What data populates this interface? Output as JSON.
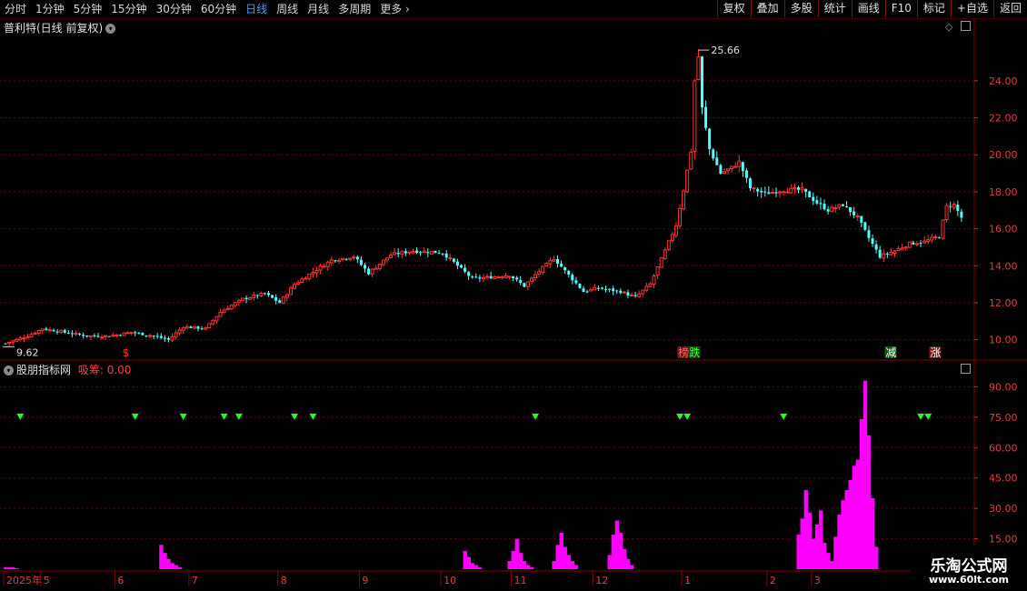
{
  "toolbar": {
    "periods": [
      {
        "label": "分时",
        "active": false
      },
      {
        "label": "1分钟",
        "active": false
      },
      {
        "label": "5分钟",
        "active": false
      },
      {
        "label": "15分钟",
        "active": false
      },
      {
        "label": "30分钟",
        "active": false
      },
      {
        "label": "60分钟",
        "active": false
      },
      {
        "label": "日线",
        "active": true
      },
      {
        "label": "周线",
        "active": false
      },
      {
        "label": "月线",
        "active": false
      },
      {
        "label": "多周期",
        "active": false
      },
      {
        "label": "更多",
        "active": false
      }
    ],
    "more_arrow": "›",
    "right_buttons": [
      "复权",
      "叠加",
      "多股",
      "统计",
      "画线",
      "F10",
      "标记",
      "+自选",
      "返回"
    ]
  },
  "main_chart": {
    "title": "普利特(日线 前复权)",
    "max_label": "25.66",
    "min_label": "9.62",
    "markers": [
      {
        "text": "$",
        "color": "#ff3030"
      },
      {
        "text": "榜",
        "color": "#ff6a6a",
        "bg": "#6a1010"
      },
      {
        "text": "跌",
        "color": "#30ff30",
        "bg": "#0a4a0a"
      },
      {
        "text": "减",
        "color": "#ffffff",
        "bg": "#0a5a0a"
      },
      {
        "text": "涨",
        "color": "#ffffff",
        "bg": "#7a1010"
      }
    ]
  },
  "indicator": {
    "title": "股朋指标网",
    "series_label": "吸筹: 0.00"
  },
  "chart_data": [
    {
      "type": "candlestick",
      "title": "普利特(日线 前复权)",
      "ylim": [
        9.0,
        26.5
      ],
      "y_ticks": [
        10,
        12,
        14,
        16,
        18,
        20,
        22,
        24
      ],
      "y_tick_labels": [
        "10.00",
        "12.00",
        "14.00",
        "16.00",
        "18.00",
        "20.00",
        "22.00",
        "24.00"
      ],
      "x_labels": [
        "2025年",
        "5",
        "6",
        "7",
        "8",
        "9",
        "10",
        "11",
        "12",
        "1",
        "2",
        "3"
      ],
      "x_label_index": [
        0,
        10,
        30,
        50,
        74,
        96,
        118,
        137,
        159,
        183,
        206,
        218
      ],
      "anchors": [
        [
          0,
          9.8
        ],
        [
          6,
          10.2
        ],
        [
          10,
          10.6
        ],
        [
          16,
          10.4
        ],
        [
          22,
          10.2
        ],
        [
          28,
          10.2
        ],
        [
          34,
          10.4
        ],
        [
          40,
          10.2
        ],
        [
          44,
          10.0
        ],
        [
          48,
          10.7
        ],
        [
          54,
          10.6
        ],
        [
          58,
          11.5
        ],
        [
          64,
          12.2
        ],
        [
          70,
          12.5
        ],
        [
          74,
          12.0
        ],
        [
          78,
          13.0
        ],
        [
          84,
          13.8
        ],
        [
          88,
          14.3
        ],
        [
          94,
          14.5
        ],
        [
          98,
          13.6
        ],
        [
          104,
          14.6
        ],
        [
          110,
          14.8
        ],
        [
          118,
          14.7
        ],
        [
          122,
          14.0
        ],
        [
          126,
          13.3
        ],
        [
          132,
          13.4
        ],
        [
          136,
          13.5
        ],
        [
          140,
          12.9
        ],
        [
          144,
          13.7
        ],
        [
          148,
          14.4
        ],
        [
          152,
          13.5
        ],
        [
          156,
          12.6
        ],
        [
          160,
          12.8
        ],
        [
          166,
          12.6
        ],
        [
          170,
          12.3
        ],
        [
          174,
          13.0
        ],
        [
          178,
          14.8
        ],
        [
          181,
          16.2
        ],
        [
          183,
          18.1
        ],
        [
          185,
          20.2
        ],
        [
          186,
          24.0
        ],
        [
          187,
          25.3
        ],
        [
          188,
          22.5
        ],
        [
          190,
          20.3
        ],
        [
          193,
          19.0
        ],
        [
          196,
          19.3
        ],
        [
          198,
          19.6
        ],
        [
          201,
          18.2
        ],
        [
          205,
          17.9
        ],
        [
          210,
          18.1
        ],
        [
          215,
          18.1
        ],
        [
          219,
          17.4
        ],
        [
          222,
          17.0
        ],
        [
          226,
          17.3
        ],
        [
          230,
          16.6
        ],
        [
          233,
          15.5
        ],
        [
          236,
          14.5
        ],
        [
          240,
          14.8
        ],
        [
          244,
          15.2
        ],
        [
          248,
          15.3
        ],
        [
          252,
          15.6
        ],
        [
          254,
          17.2
        ],
        [
          256,
          17.3
        ],
        [
          258,
          16.6
        ]
      ],
      "ohlc_rule": "generated from anchors"
    },
    {
      "type": "bar",
      "series_name": "吸筹",
      "ylim": [
        12,
        96
      ],
      "y_ticks": [
        15,
        30,
        45,
        60,
        75,
        90
      ],
      "y_tick_labels": [
        "15.00",
        "30.00",
        "45.00",
        "60.00",
        "75.00",
        "90.00"
      ],
      "bars": [
        [
          0,
          1
        ],
        [
          1,
          1
        ],
        [
          2,
          1
        ],
        [
          3,
          0.5
        ],
        [
          42,
          12
        ],
        [
          43,
          8
        ],
        [
          44,
          5
        ],
        [
          45,
          3
        ],
        [
          46,
          2
        ],
        [
          47,
          1
        ],
        [
          124,
          9
        ],
        [
          125,
          6
        ],
        [
          126,
          3
        ],
        [
          127,
          2
        ],
        [
          128,
          1
        ],
        [
          136,
          4
        ],
        [
          137,
          9
        ],
        [
          138,
          15
        ],
        [
          139,
          8
        ],
        [
          140,
          4
        ],
        [
          141,
          2
        ],
        [
          142,
          1
        ],
        [
          148,
          4
        ],
        [
          149,
          12
        ],
        [
          150,
          18
        ],
        [
          151,
          11
        ],
        [
          152,
          7
        ],
        [
          153,
          4
        ],
        [
          154,
          2
        ],
        [
          163,
          7
        ],
        [
          164,
          17
        ],
        [
          165,
          24
        ],
        [
          166,
          18
        ],
        [
          167,
          10
        ],
        [
          168,
          5
        ],
        [
          169,
          2
        ],
        [
          214,
          17
        ],
        [
          215,
          25
        ],
        [
          216,
          39
        ],
        [
          217,
          28
        ],
        [
          218,
          15
        ],
        [
          219,
          22
        ],
        [
          220,
          29
        ],
        [
          221,
          13
        ],
        [
          222,
          8
        ],
        [
          223,
          4
        ],
        [
          224,
          16
        ],
        [
          225,
          27
        ],
        [
          226,
          34
        ],
        [
          227,
          39
        ],
        [
          228,
          44
        ],
        [
          229,
          51
        ],
        [
          230,
          54
        ],
        [
          231,
          74
        ],
        [
          232,
          93
        ],
        [
          233,
          66
        ],
        [
          234,
          35
        ],
        [
          235,
          11
        ]
      ],
      "signals_level": 75,
      "signals_x": [
        4,
        35,
        48,
        59,
        63,
        78,
        83,
        143,
        182,
        184,
        210,
        247,
        249
      ]
    }
  ]
}
